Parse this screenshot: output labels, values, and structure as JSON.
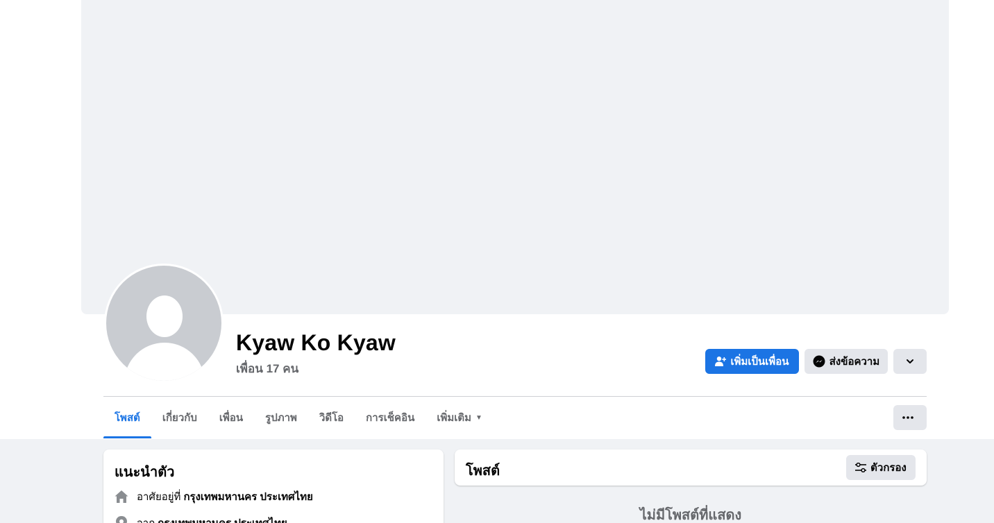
{
  "profile": {
    "name": "Kyaw Ko Kyaw",
    "friend_count": "เพื่อน 17 คน"
  },
  "actions": {
    "add_friend_label": "เพิ่มเป็นเพื่อน",
    "message_label": "ส่งข้อความ"
  },
  "tabs": [
    {
      "label": "โพสต์",
      "active": true
    },
    {
      "label": "เกี่ยวกับ",
      "active": false
    },
    {
      "label": "เพื่อน",
      "active": false
    },
    {
      "label": "รูปภาพ",
      "active": false
    },
    {
      "label": "วิดีโอ",
      "active": false
    },
    {
      "label": "การเช็คอิน",
      "active": false
    },
    {
      "label": "เพิ่มเติม",
      "active": false
    }
  ],
  "intro": {
    "title": "แนะนำตัว",
    "lives_in_prefix": "อาศัยอยู่ที่",
    "lives_in_value": "กรุงเทพมหานคร ประเทศไทย",
    "from_prefix": "จาก",
    "from_value": "กรุงเทพมหานคร ประเทศไทย"
  },
  "posts": {
    "title": "โพสต์",
    "filter_label": "ตัวกรอง",
    "empty_message": "ไม่มีโพสต์ที่แสดง"
  },
  "colors": {
    "accent": "#1b74e4",
    "page_background": "#f0f2f5",
    "secondary_button": "#e4e6eb",
    "secondary_text": "#65676b"
  }
}
